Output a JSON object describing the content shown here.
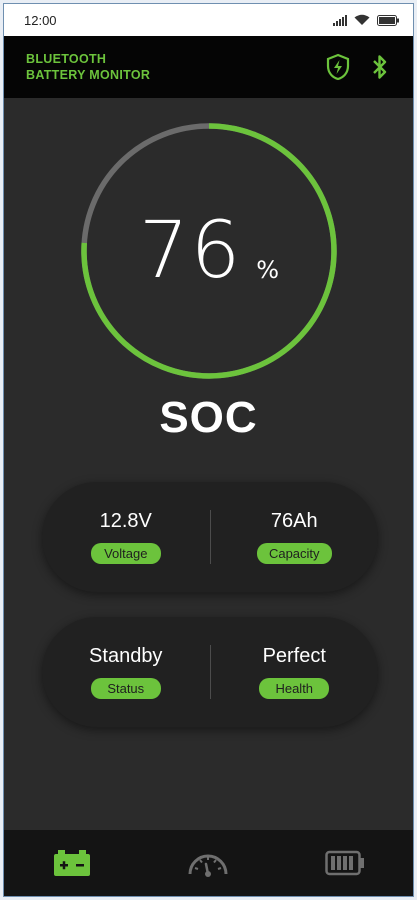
{
  "statusbar": {
    "time": "12:00"
  },
  "header": {
    "title": "Bluetooth\nBattery Monitor"
  },
  "soc": {
    "value": "76",
    "unit": "%",
    "label": "SOC",
    "percent": 76
  },
  "metrics": {
    "voltage": {
      "value": "12.8V",
      "label": "Voltage"
    },
    "capacity": {
      "value": "76Ah",
      "label": "Capacity"
    },
    "status": {
      "value": "Standby",
      "label": "Status"
    },
    "health": {
      "value": "Perfect",
      "label": "Health"
    }
  },
  "colors": {
    "accent": "#6cc33c",
    "track": "#6b6b6b",
    "background": "#2b2b2b"
  },
  "tabs": [
    {
      "icon": "battery-terminal-icon",
      "active": true
    },
    {
      "icon": "speedometer-icon",
      "active": false
    },
    {
      "icon": "battery-level-icon",
      "active": false
    }
  ]
}
